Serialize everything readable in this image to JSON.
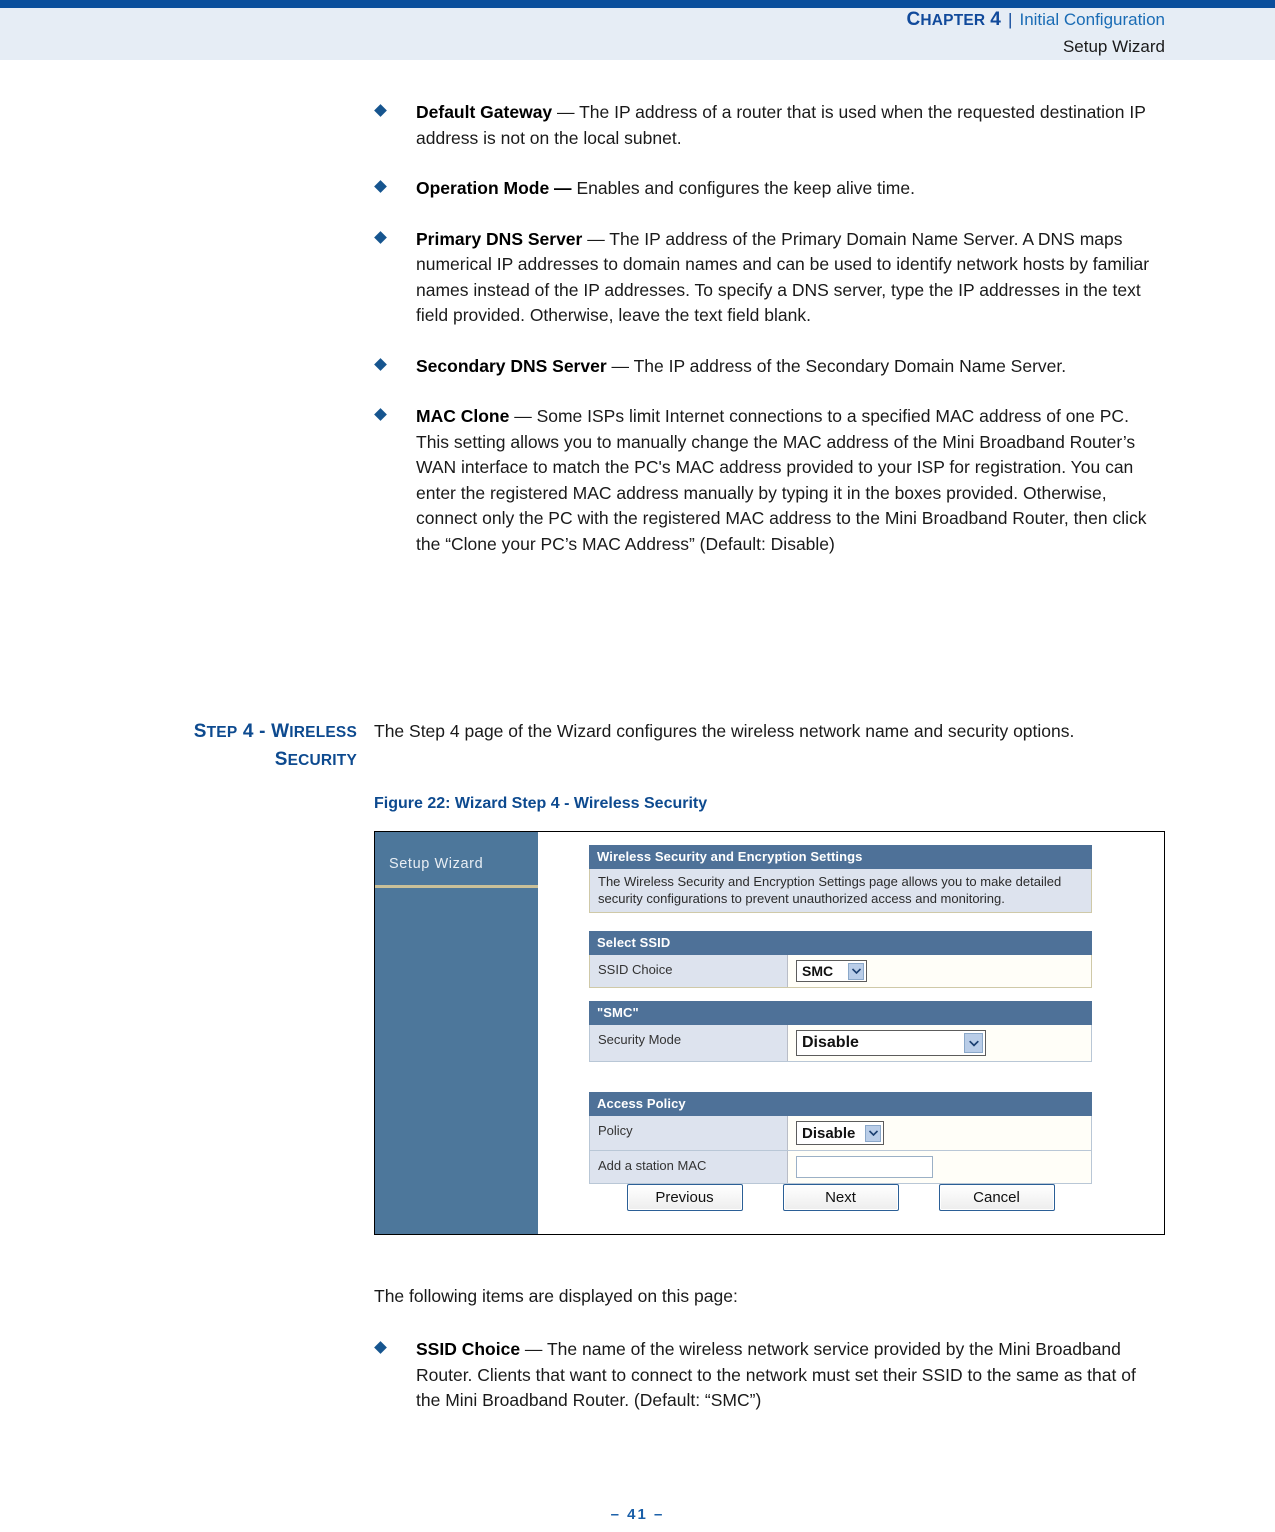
{
  "header": {
    "chapter_label_cap": "C",
    "chapter_label_rest": "HAPTER",
    "chapter_number": "4",
    "separator": "|",
    "chapter_name": "Initial Configuration",
    "subtitle": "Setup Wizard"
  },
  "bullets_top": [
    {
      "term": "Default Gateway",
      "dash": " — ",
      "text": "The IP address of a router that is used when the requested destination IP address is not on the local subnet."
    },
    {
      "term": "Operation Mode —",
      "dash": " ",
      "text": "Enables and configures the keep alive time."
    },
    {
      "term": "Primary DNS Server",
      "dash": " — ",
      "text": "The IP address of the Primary Domain Name Server. A DNS maps numerical IP addresses to domain names and can be used to identify network hosts by familiar names instead of the IP addresses. To specify a DNS server, type the IP addresses in the text field provided. Otherwise, leave the text field blank."
    },
    {
      "term": "Secondary DNS Server",
      "dash": " — ",
      "text": "The IP address of the Secondary Domain Name Server."
    },
    {
      "term": "MAC Clone",
      "dash": " — ",
      "text": "Some ISPs limit Internet connections to a specified MAC address of one PC. This setting allows you to manually change the MAC address of the Mini Broadband Router’s WAN interface to match the PC's MAC address provided to your ISP for registration. You can enter the registered MAC address manually by typing it in the boxes provided. Otherwise, connect only the PC with the registered MAC address to the Mini Broadband Router, then click the “Clone your PC’s MAC Address” (Default: Disable)"
    }
  ],
  "section": {
    "margin_heading_line1_a": "S",
    "margin_heading_line1_b": "TEP",
    "margin_heading_line1_c": " 4 - W",
    "margin_heading_line1_d": "IRELESS",
    "margin_heading_line2_a": "S",
    "margin_heading_line2_b": "ECURITY",
    "lead_paragraph": "The Step 4 page of the Wizard configures the wireless network name and security options.",
    "figure_caption": "Figure 22:  Wizard Step 4 - Wireless Security"
  },
  "figure": {
    "sidebar": {
      "title": "Setup Wizard"
    },
    "intro": {
      "header": "Wireless Security and Encryption Settings",
      "note": "The Wireless Security and Encryption Settings page allows you to make detailed security configurations to prevent unauthorized access and monitoring."
    },
    "select_ssid": {
      "header": "Select SSID",
      "row_label": "SSID Choice",
      "value": "SMC"
    },
    "smc": {
      "header": "\"SMC\"",
      "row_label": "Security Mode",
      "value": "Disable"
    },
    "access_policy": {
      "header": "Access Policy",
      "policy_label": "Policy",
      "policy_value": "Disable",
      "mac_label": "Add a station MAC",
      "mac_value": ""
    },
    "buttons": {
      "previous": "Previous",
      "next": "Next",
      "cancel": "Cancel"
    }
  },
  "body_after_figure": {
    "intro_line": "The following items are displayed on this page:",
    "bullets": [
      {
        "term": "SSID Choice",
        "dash": " — ",
        "text": "The name of the wireless network service provided by the Mini Broadband Router. Clients that want to connect to the network must set their SSID to the same as that of the Mini Broadband Router. (Default: “SMC”)"
      }
    ]
  },
  "footer": {
    "page_number": "–  41  –"
  },
  "colors": {
    "brand_blue": "#0a4f9c",
    "header_band": "#e6edf5",
    "heading_blue": "#0d4a8f",
    "ui_panel_blue": "#4e7198",
    "ui_sidebar_blue": "#4d779b",
    "ui_label_bg": "#dde3ee"
  }
}
